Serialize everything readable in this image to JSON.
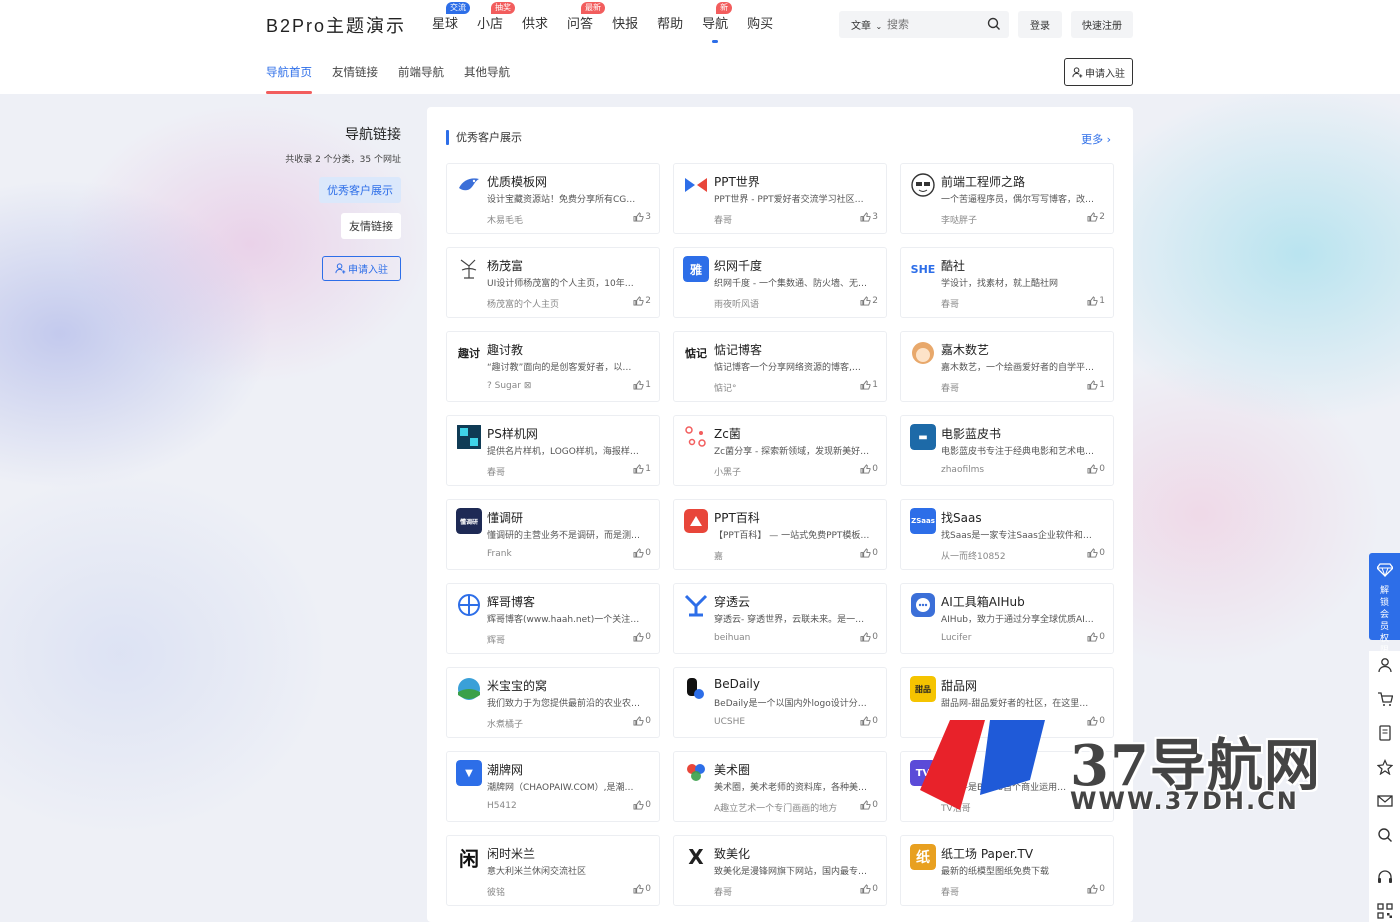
{
  "header": {
    "logo": "B2Pro主题演示",
    "nav": [
      {
        "label": "星球",
        "badge": "交流",
        "badge_color": "#2d6ee8"
      },
      {
        "label": "小店",
        "badge": "抽奖",
        "badge_color": "#f25d5d"
      },
      {
        "label": "供求",
        "badge": "",
        "badge_color": ""
      },
      {
        "label": "问答",
        "badge": "最新",
        "badge_color": "#f25d5d"
      },
      {
        "label": "快报",
        "badge": "",
        "badge_color": ""
      },
      {
        "label": "帮助",
        "badge": "",
        "badge_color": ""
      },
      {
        "label": "导航",
        "badge": "新",
        "badge_color": "#f25d5d",
        "active": true
      },
      {
        "label": "购买",
        "badge": "",
        "badge_color": ""
      }
    ],
    "search": {
      "type": "文章",
      "placeholder": "搜索"
    },
    "login": "登录",
    "register": "快速注册"
  },
  "subnav": {
    "items": [
      "导航首页",
      "友情链接",
      "前端导航",
      "其他导航"
    ],
    "active_index": 0,
    "apply": "申请入驻"
  },
  "sidebar": {
    "title": "导航链接",
    "count": "共收录 2 个分类，35 个网址",
    "links": [
      "优秀客户展示",
      "友情链接"
    ],
    "apply": "申请入驻"
  },
  "main": {
    "title": "优秀客户展示",
    "more": "更多",
    "cards": [
      {
        "name": "优质模板网",
        "desc": "设计宝藏资源站！免费分享所有CG…",
        "author": "木易毛毛",
        "likes": "3",
        "icon": "bird",
        "icon_color": "#3b6fd8"
      },
      {
        "name": "PPT世界",
        "desc": "PPT世界 - PPT爱好者交流学习社区…",
        "author": "春哥",
        "likes": "3",
        "icon": "bowtie",
        "icon_color": "#2d6ee8"
      },
      {
        "name": "前端工程师之路",
        "desc": "一个苦逼程序员，偶尔写写博客，改…",
        "author": "李哒胖子",
        "likes": "2",
        "icon": "glasses",
        "icon_color": "#333"
      },
      {
        "name": "杨茂富",
        "desc": "UI设计师杨茂富的个人主页，10年…",
        "author": "杨茂富的个人主页",
        "likes": "2",
        "icon": "sketch",
        "icon_color": "#444"
      },
      {
        "name": "织网千度",
        "desc": "织网千度 - 一个集数通、防火墙、无…",
        "author": "雨夜听风语",
        "likes": "2",
        "icon": "雅",
        "icon_color": "#2d6ee8"
      },
      {
        "name": "酷社",
        "desc": "学设计，找素材，就上酷社网",
        "author": "春哥",
        "likes": "1",
        "icon": "SHE",
        "icon_color": "#2d6ee8"
      },
      {
        "name": "趣讨教",
        "desc": "“趣讨教”面向的是创客爱好者，以…",
        "author": "? Sugar ⊠",
        "likes": "1",
        "icon": "趣讨",
        "icon_color": "#222"
      },
      {
        "name": "惦记博客",
        "desc": "惦记博客一个分享网络资源的博客,…",
        "author": "惦记°",
        "likes": "1",
        "icon": "惦记",
        "icon_color": "#222"
      },
      {
        "name": "嘉木数艺",
        "desc": "嘉木数艺，一个绘画爱好者的自学平…",
        "author": "春哥",
        "likes": "1",
        "icon": "girl",
        "icon_color": "#e8a86b"
      },
      {
        "name": "PS样机网",
        "desc": "提供名片样机，LOGO样机，海报样…",
        "author": "春哥",
        "likes": "1",
        "icon": "ps",
        "icon_color": "#0f3b55"
      },
      {
        "name": "Zc菌",
        "desc": "Zc菌分享 - 探索新领域，发现新美好…",
        "author": "小黑子",
        "likes": "0",
        "icon": "dots",
        "icon_color": "#f25d5d"
      },
      {
        "name": "电影蓝皮书",
        "desc": "电影蓝皮书专注于经典电影和艺术电…",
        "author": "zhaofilms",
        "likes": "0",
        "icon": "film",
        "icon_color": "#1d6aa8"
      },
      {
        "name": "懂调研",
        "desc": "懂调研的主营业务不是调研，而是测…",
        "author": "Frank",
        "likes": "0",
        "icon": "懂调研",
        "icon_color": "#1e2a55"
      },
      {
        "name": "PPT百科",
        "desc": "【PPT百科】 — 一站式免费PPT模板…",
        "author": "嘉",
        "likes": "0",
        "icon": "ppt",
        "icon_color": "#e8463a"
      },
      {
        "name": "找Saas",
        "desc": "找Saas是一家专注Saas企业软件和…",
        "author": "从一而终10852",
        "likes": "0",
        "icon": "ZSaas",
        "icon_color": "#2d6ee8"
      },
      {
        "name": "辉哥博客",
        "desc": "辉哥博客(www.haah.net)一个关注…",
        "author": "辉哥",
        "likes": "0",
        "icon": "globe",
        "icon_color": "#2d6ee8"
      },
      {
        "name": "穿透云",
        "desc": "穿透云- 穿透世界，云联未来。是一…",
        "author": "beihuan",
        "likes": "0",
        "icon": "y",
        "icon_color": "#2d6ee8"
      },
      {
        "name": "AI工具箱AIHub",
        "desc": "AIHub，致力于通过分享全球优质AI…",
        "author": "Lucifer",
        "likes": "0",
        "icon": "chat",
        "icon_color": "#3b6fd8"
      },
      {
        "name": "米宝宝的窝",
        "desc": "我们致力于为您提供最前沿的农业农…",
        "author": "水煮橘子",
        "likes": "0",
        "icon": "field",
        "icon_color": "#3aa0d8"
      },
      {
        "name": "BeDaily",
        "desc": "BeDaily是一个以国内外logo设计分…",
        "author": "UCSHE",
        "likes": "0",
        "icon": "B",
        "icon_color": "#111"
      },
      {
        "name": "甜品网",
        "desc": "甜品网-甜品爱好者的社区，在这里…",
        "author": "",
        "likes": "0",
        "icon": "甜品",
        "icon_color": "#f5c400"
      },
      {
        "name": "潮牌网",
        "desc": "潮牌网（CHAOPAIW.COM）,是潮…",
        "author": "H5412",
        "likes": "0",
        "icon": "shirt",
        "icon_color": "#2d6ee8"
      },
      {
        "name": "美术圈",
        "desc": "美术圈，美术老师的资料库，各种美…",
        "author": "A趣立艺术一个专门画画的地方",
        "likes": "0",
        "icon": "palette",
        "icon_color": "#e8463a"
      },
      {
        "name": "",
        "desc": "播助手是B2Pro首个商业运用…",
        "author": "TV浩哥",
        "likes": "",
        "icon": "tv",
        "icon_color": "#5b4bd8"
      },
      {
        "name": "闲时米兰",
        "desc": "意大利米兰休闲交流社区",
        "author": "彼铭",
        "likes": "0",
        "icon": "闲",
        "icon_color": "#111"
      },
      {
        "name": "致美化",
        "desc": "致美化是漫锋网旗下网站，国内最专…",
        "author": "春哥",
        "likes": "0",
        "icon": "X",
        "icon_color": "#222"
      },
      {
        "name": "纸工场 Paper.TV",
        "desc": "最新的纸模型图纸免费下载",
        "author": "春哥",
        "likes": "0",
        "icon": "纸",
        "icon_color": "#e8a020"
      }
    ]
  },
  "float": {
    "vip": "解锁会员权限",
    "tools": [
      "user-icon",
      "cart-icon",
      "doc-icon",
      "star-icon",
      "mail-icon",
      "search-icon",
      "headset-icon",
      "qrcode-icon"
    ]
  },
  "watermark": {
    "text": "37导航网",
    "url": "WWW.37DH.CN"
  }
}
